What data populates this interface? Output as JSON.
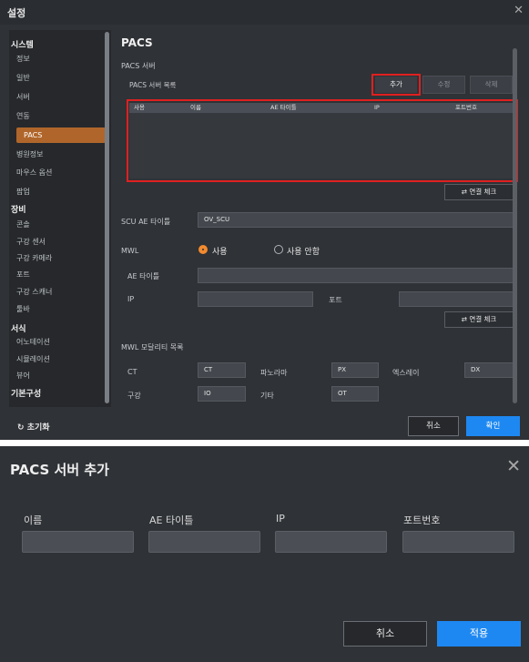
{
  "settings": {
    "title": "설정",
    "sidebar": {
      "groups": [
        {
          "label": "시스템",
          "items": [
            "정보",
            "일반",
            "서버",
            "연동",
            "PACS",
            "병원정보",
            "마우스 옵션",
            "팝업"
          ]
        },
        {
          "label": "장비",
          "items": [
            "콘솔",
            "구강 센서",
            "구강 카메라",
            "포트",
            "구강 스캐너",
            "툴바"
          ]
        },
        {
          "label": "서식",
          "items": [
            "어노테이션",
            "시뮬레이션",
            "뷰어"
          ]
        },
        {
          "label": "기본구성",
          "items": []
        }
      ],
      "active": "PACS"
    },
    "content": {
      "heading": "PACS",
      "section_label": "PACS 서버",
      "server_list_label": "PACS 서버 목록",
      "buttons": {
        "add": "추가",
        "edit": "수정",
        "delete": "삭제"
      },
      "table_columns": [
        "사용",
        "이름",
        "AE 타이틀",
        "IP",
        "포트번호"
      ],
      "check_connection": "연결 체크",
      "scu_ae_title_label": "SCU AE 타이틀",
      "scu_ae_title_value": "OV_SCU",
      "mwl": {
        "label": "MWL",
        "option_use": "사용",
        "option_unused": "사용 안함",
        "ae_title_label": "AE 타이틀",
        "ip_label": "IP",
        "port_label": "포트"
      },
      "modality": {
        "label": "MWL 모달리티 목록",
        "items": [
          {
            "name": "CT",
            "value": "CT"
          },
          {
            "name": "파노라마",
            "value": "PX"
          },
          {
            "name": "엑스레이",
            "value": "DX"
          },
          {
            "name": "구강",
            "value": "IO"
          },
          {
            "name": "기타",
            "value": "OT"
          }
        ]
      }
    },
    "footer": {
      "reset": "초기화",
      "cancel": "취소",
      "confirm": "확인"
    }
  },
  "dialog": {
    "title": "PACS 서버 추가",
    "fields": [
      "이름",
      "AE 타이틀",
      "IP",
      "포트번호"
    ],
    "cancel": "취소",
    "apply": "적용"
  },
  "colors": {
    "accent": "#b0662a",
    "radio": "#f28a2e",
    "primary": "#1e88f2",
    "highlight": "#e02020"
  }
}
